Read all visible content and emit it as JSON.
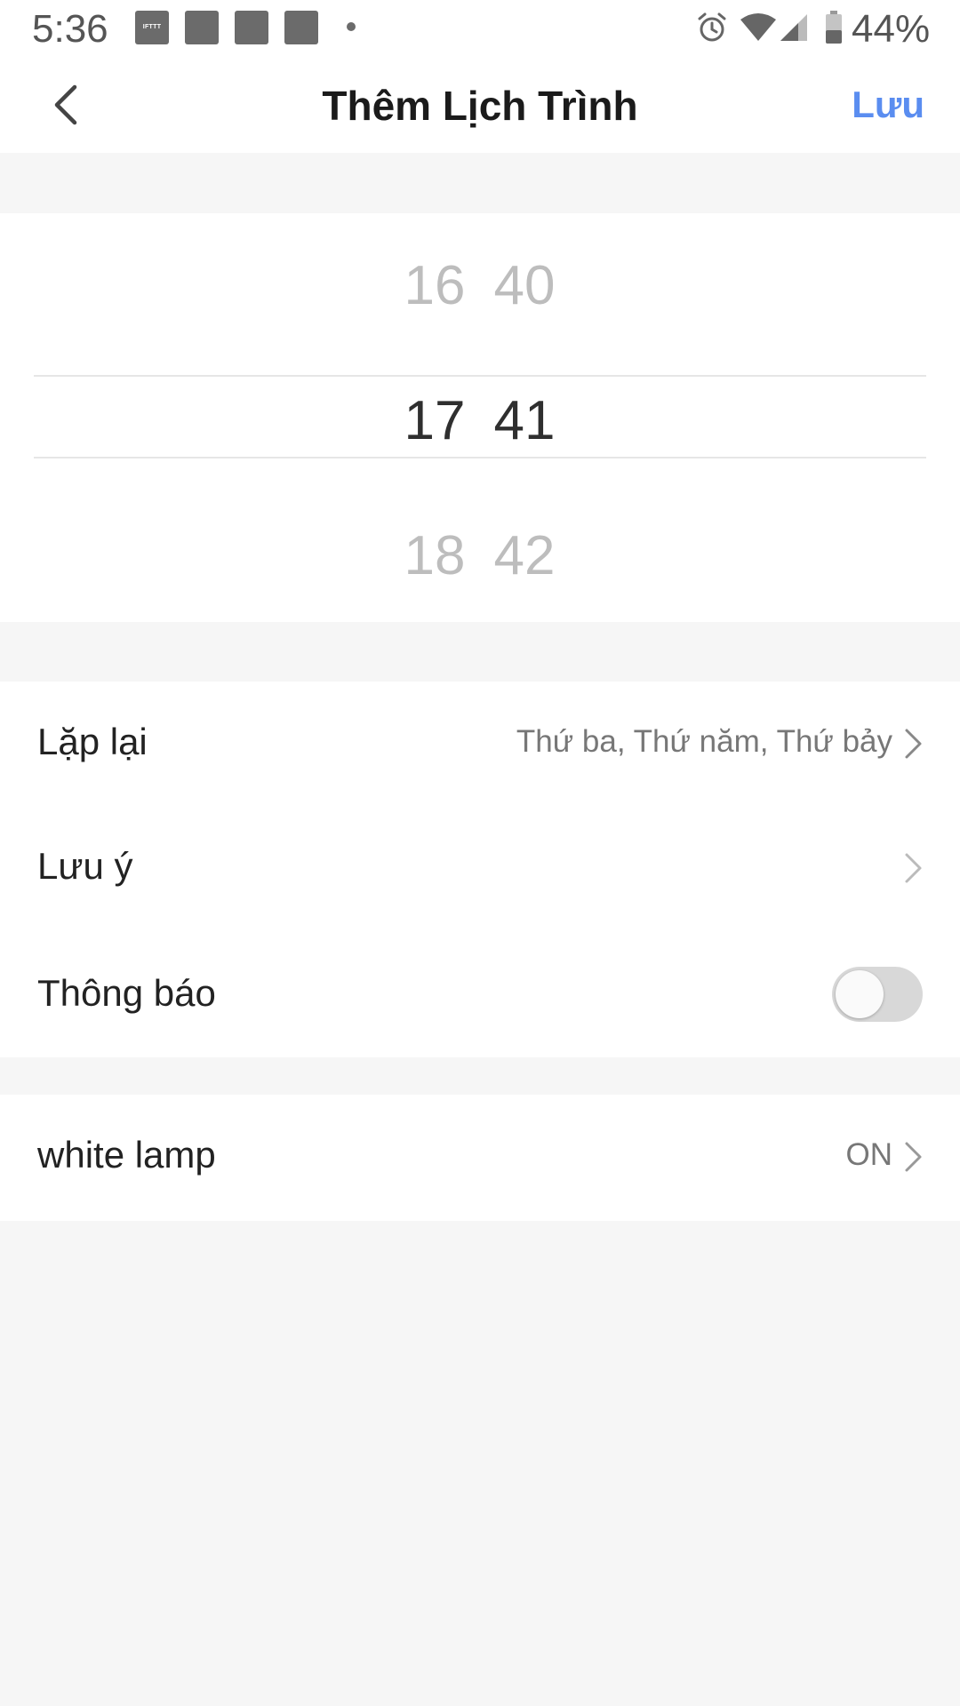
{
  "status_bar": {
    "time": "5:36",
    "ifttt_label": "IFTTT",
    "battery_percent": "44%"
  },
  "header": {
    "title": "Thêm Lịch Trình",
    "save_label": "Lưu",
    "accent_color": "#5a8df0"
  },
  "time_picker": {
    "hours": [
      "16",
      "17",
      "18"
    ],
    "minutes": [
      "40",
      "41",
      "42"
    ],
    "selected_hour": "17",
    "selected_minute": "41"
  },
  "settings": {
    "repeat_label": "Lặp lại",
    "repeat_value": "Thứ ba, Thứ năm, Thứ bảy",
    "note_label": "Lưu ý",
    "notify_label": "Thông báo",
    "notify_enabled": false
  },
  "device": {
    "name": "white lamp",
    "state": "ON"
  }
}
